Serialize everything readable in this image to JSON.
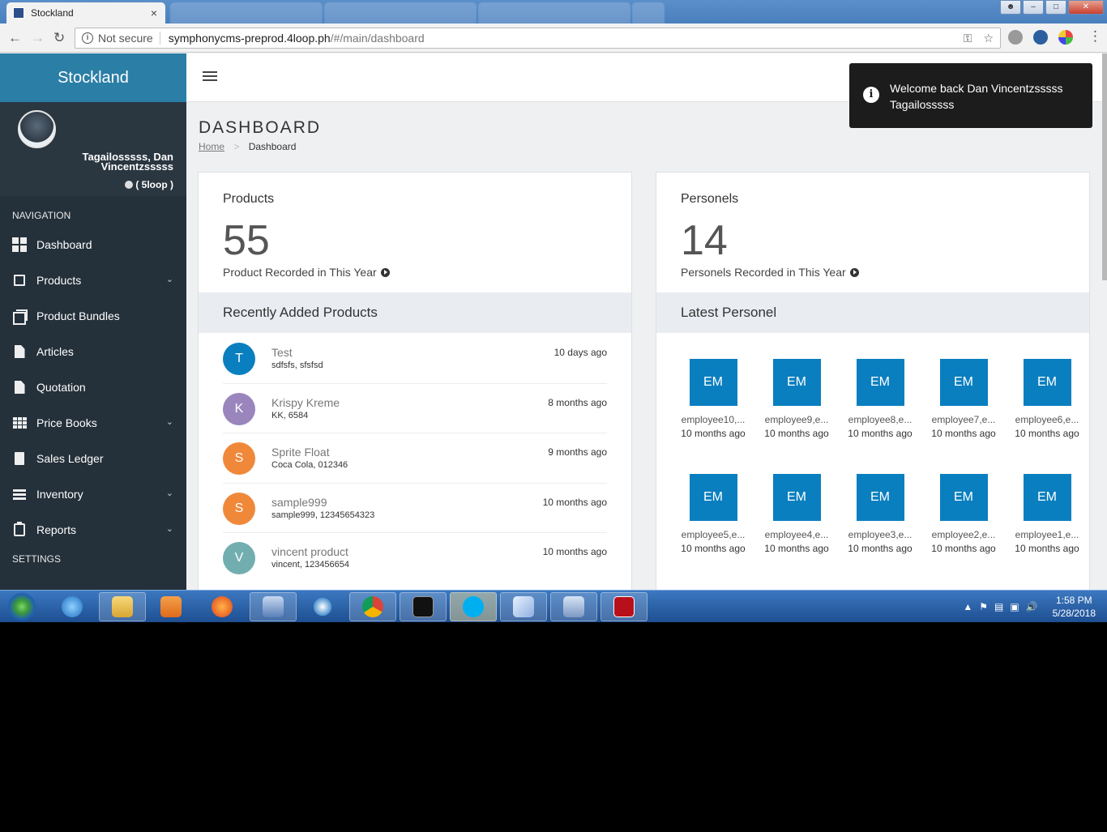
{
  "browser": {
    "tab_title": "Stockland",
    "tab_close": "×",
    "address_security": "Not secure",
    "url_host": "symphonycms-preprod.4loop.ph",
    "url_path": "/#/main/dashboard"
  },
  "sidebar": {
    "brand": "Stockland",
    "user_name": "Tagailosssss, Dan Vincentzsssss",
    "user_status": "( 5loop )",
    "nav_header": "NAVIGATION",
    "settings_header": "SETTINGS",
    "items": [
      {
        "label": "Dashboard",
        "icon": "dashboard-icon"
      },
      {
        "label": "Products",
        "icon": "products-icon",
        "has_chevron": true
      },
      {
        "label": "Product Bundles",
        "icon": "product-bundles-icon"
      },
      {
        "label": "Articles",
        "icon": "articles-icon"
      },
      {
        "label": "Quotation",
        "icon": "quotation-icon"
      },
      {
        "label": "Price Books",
        "icon": "price-books-icon",
        "has_chevron": true
      },
      {
        "label": "Sales Ledger",
        "icon": "sales-ledger-icon"
      },
      {
        "label": "Inventory",
        "icon": "inventory-icon",
        "has_chevron": true
      },
      {
        "label": "Reports",
        "icon": "reports-icon",
        "has_chevron": true
      }
    ]
  },
  "page": {
    "title": "DASHBOARD",
    "breadcrumb_home": "Home",
    "breadcrumb_sep": ">",
    "breadcrumb_current": "Dashboard"
  },
  "products_card": {
    "title": "Products",
    "count": "55",
    "subtitle": "Product Recorded in This Year",
    "list_title": "Recently Added Products",
    "items": [
      {
        "initial": "T",
        "name": "Test",
        "desc": "sdfsfs, sfsfsd",
        "time": "10 days ago",
        "color": "#0a7fbf"
      },
      {
        "initial": "K",
        "name": "Krispy Kreme",
        "desc": "KK, 6584",
        "time": "8 months ago",
        "color": "#9a86bd"
      },
      {
        "initial": "S",
        "name": "Sprite Float",
        "desc": "Coca Cola, 012346",
        "time": "9 months ago",
        "color": "#f0883a"
      },
      {
        "initial": "S",
        "name": "sample999",
        "desc": "sample999, 12345654323",
        "time": "10 months ago",
        "color": "#f0883a"
      },
      {
        "initial": "V",
        "name": "vincent product",
        "desc": "vincent, 123456654",
        "time": "10 months ago",
        "color": "#72aeb0"
      }
    ]
  },
  "personels_card": {
    "title": "Personels",
    "count": "14",
    "subtitle": "Personels Recorded in This Year",
    "list_title": "Latest Personel",
    "items": [
      {
        "initials": "EM",
        "name": "employee10,...",
        "time": "10 months ago"
      },
      {
        "initials": "EM",
        "name": "employee9,e...",
        "time": "10 months ago"
      },
      {
        "initials": "EM",
        "name": "employee8,e...",
        "time": "10 months ago"
      },
      {
        "initials": "EM",
        "name": "employee7,e...",
        "time": "10 months ago"
      },
      {
        "initials": "EM",
        "name": "employee6,e...",
        "time": "10 months ago"
      },
      {
        "initials": "EM",
        "name": "employee5,e...",
        "time": "10 months ago"
      },
      {
        "initials": "EM",
        "name": "employee4,e...",
        "time": "10 months ago"
      },
      {
        "initials": "EM",
        "name": "employee3,e...",
        "time": "10 months ago"
      },
      {
        "initials": "EM",
        "name": "employee2,e...",
        "time": "10 months ago"
      },
      {
        "initials": "EM",
        "name": "employee1,e...",
        "time": "10 months ago"
      }
    ]
  },
  "toast": {
    "message": "Welcome back Dan Vincentzsssss Tagailosssss",
    "icon": "info-icon"
  },
  "taskbar": {
    "time": "1:58 PM",
    "date": "5/28/2018",
    "apps": [
      "internet-explorer",
      "file-explorer",
      "media-player",
      "firefox",
      "network-tool",
      "wifi-tool",
      "chrome",
      "command-prompt",
      "skype",
      "notepad",
      "remote-desktop",
      "filezilla"
    ]
  },
  "colors": {
    "brand": "#2b7ea6",
    "sidebar": "#24303a",
    "accent": "#0a7fbf"
  }
}
